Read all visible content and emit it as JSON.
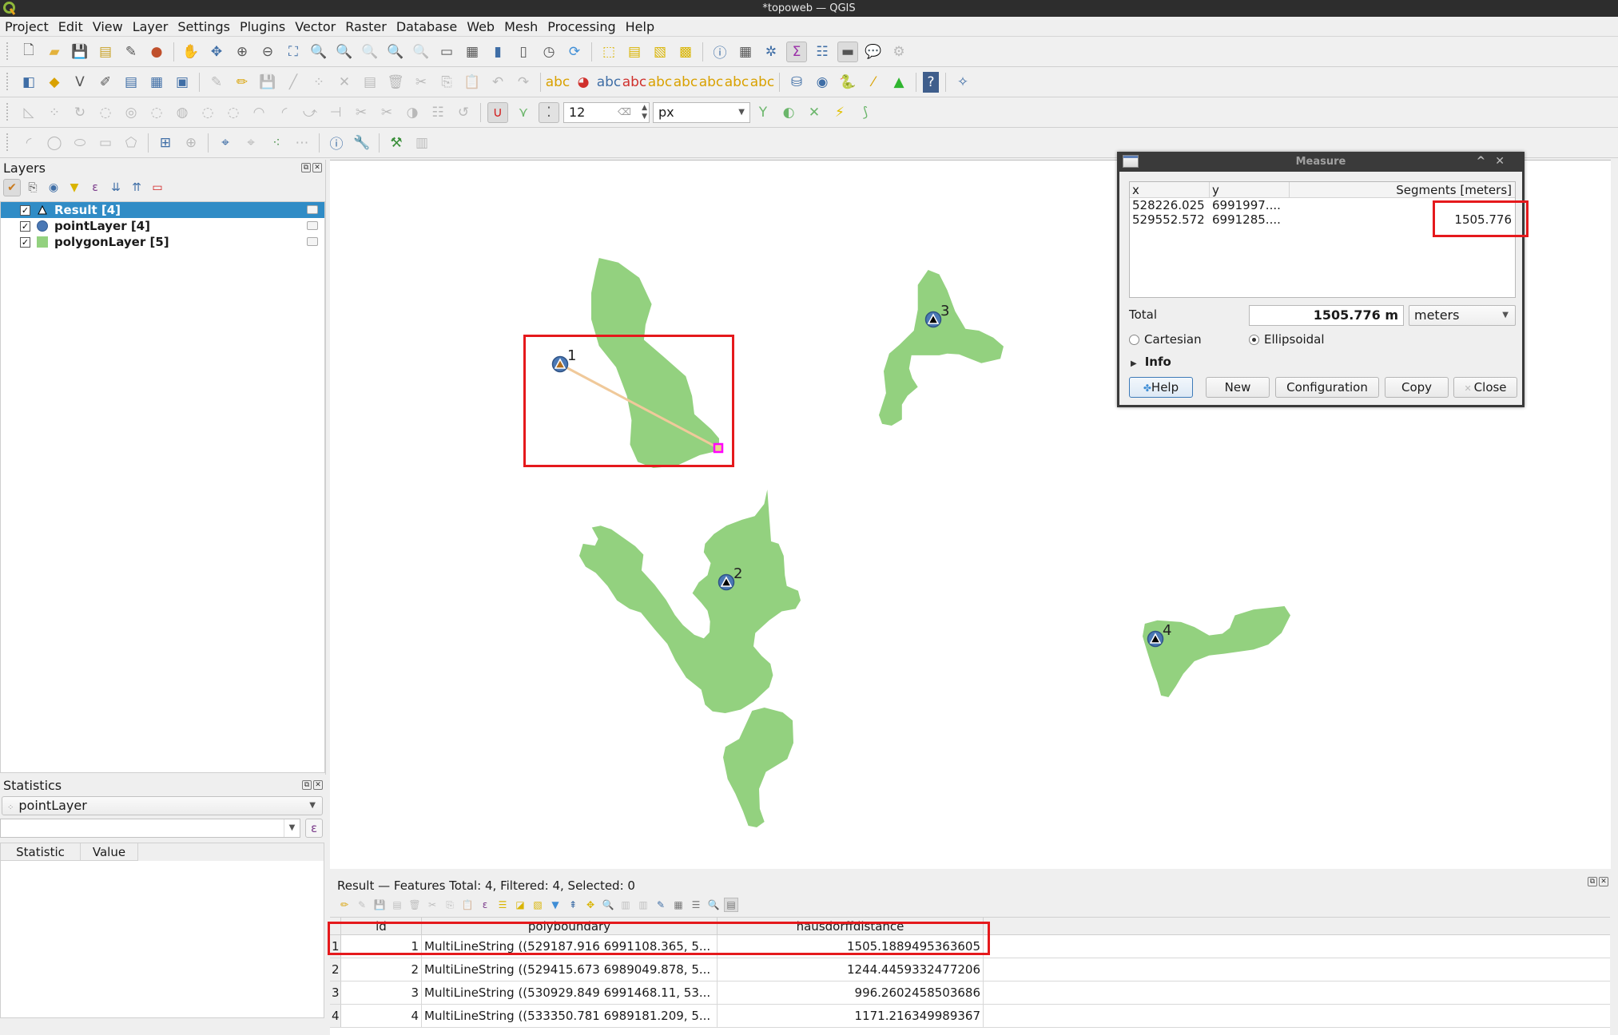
{
  "window": {
    "title": "*topoweb — QGIS"
  },
  "menu": [
    "Project",
    "Edit",
    "View",
    "Layer",
    "Settings",
    "Plugins",
    "Vector",
    "Raster",
    "Database",
    "Web",
    "Mesh",
    "Processing",
    "Help"
  ],
  "toolbar": {
    "snapping_tolerance": "12",
    "snapping_units": "px"
  },
  "layers_panel": {
    "title": "Layers",
    "layers": [
      {
        "name": "Result [4]",
        "checked": true,
        "selected": true,
        "symbol": "triangle-icon"
      },
      {
        "name": "pointLayer [4]",
        "checked": true,
        "selected": false,
        "symbol": "circle-icon",
        "color": "#4a78b5"
      },
      {
        "name": "polygonLayer [5]",
        "checked": true,
        "selected": false,
        "symbol": "square-icon",
        "color": "#93d17f"
      }
    ]
  },
  "statistics_panel": {
    "title": "Statistics",
    "layer": "pointLayer",
    "field": "",
    "columns": [
      "Statistic",
      "Value"
    ]
  },
  "map": {
    "polygon_color": "#93d17f",
    "point_color": "#4a78b5",
    "point_labels": [
      "1",
      "2",
      "3",
      "4"
    ],
    "measure_line_color": "#f0c99a",
    "measure_end_marker_color": "#ff00ff"
  },
  "measure_dialog": {
    "title": "Measure",
    "columns": [
      "x",
      "y",
      "Segments [meters]"
    ],
    "rows": [
      {
        "x": "528226.025",
        "y": "6991997....",
        "segment": ""
      },
      {
        "x": "529552.572",
        "y": "6991285....",
        "segment": "1505.776"
      }
    ],
    "total_label": "Total",
    "total_value": "1505.776 m",
    "units": "meters",
    "mode_options": [
      {
        "label": "Cartesian",
        "selected": false
      },
      {
        "label": "Ellipsoidal",
        "selected": true
      }
    ],
    "info_label": "Info",
    "buttons": {
      "help": "Help",
      "new": "New",
      "configuration": "Configuration",
      "copy": "Copy",
      "close": "Close"
    }
  },
  "attribute_table": {
    "title": "Result — Features Total: 4, Filtered: 4, Selected: 0",
    "columns": [
      "id",
      "polyboundary",
      "hausdorffdistance"
    ],
    "rows": [
      {
        "row": "1",
        "id": "1",
        "polyboundary": "MultiLineString ((529187.916 6991108.365, 5...",
        "hausdorffdistance": "1505.1889495363605"
      },
      {
        "row": "2",
        "id": "2",
        "polyboundary": "MultiLineString ((529415.673 6989049.878, 5...",
        "hausdorffdistance": "1244.4459332477206"
      },
      {
        "row": "3",
        "id": "3",
        "polyboundary": "MultiLineString ((530929.849 6991468.11, 53...",
        "hausdorffdistance": "996.2602458503686"
      },
      {
        "row": "4",
        "id": "4",
        "polyboundary": "MultiLineString ((533350.781 6989181.209, 5...",
        "hausdorffdistance": "1171.216349989367"
      }
    ]
  }
}
